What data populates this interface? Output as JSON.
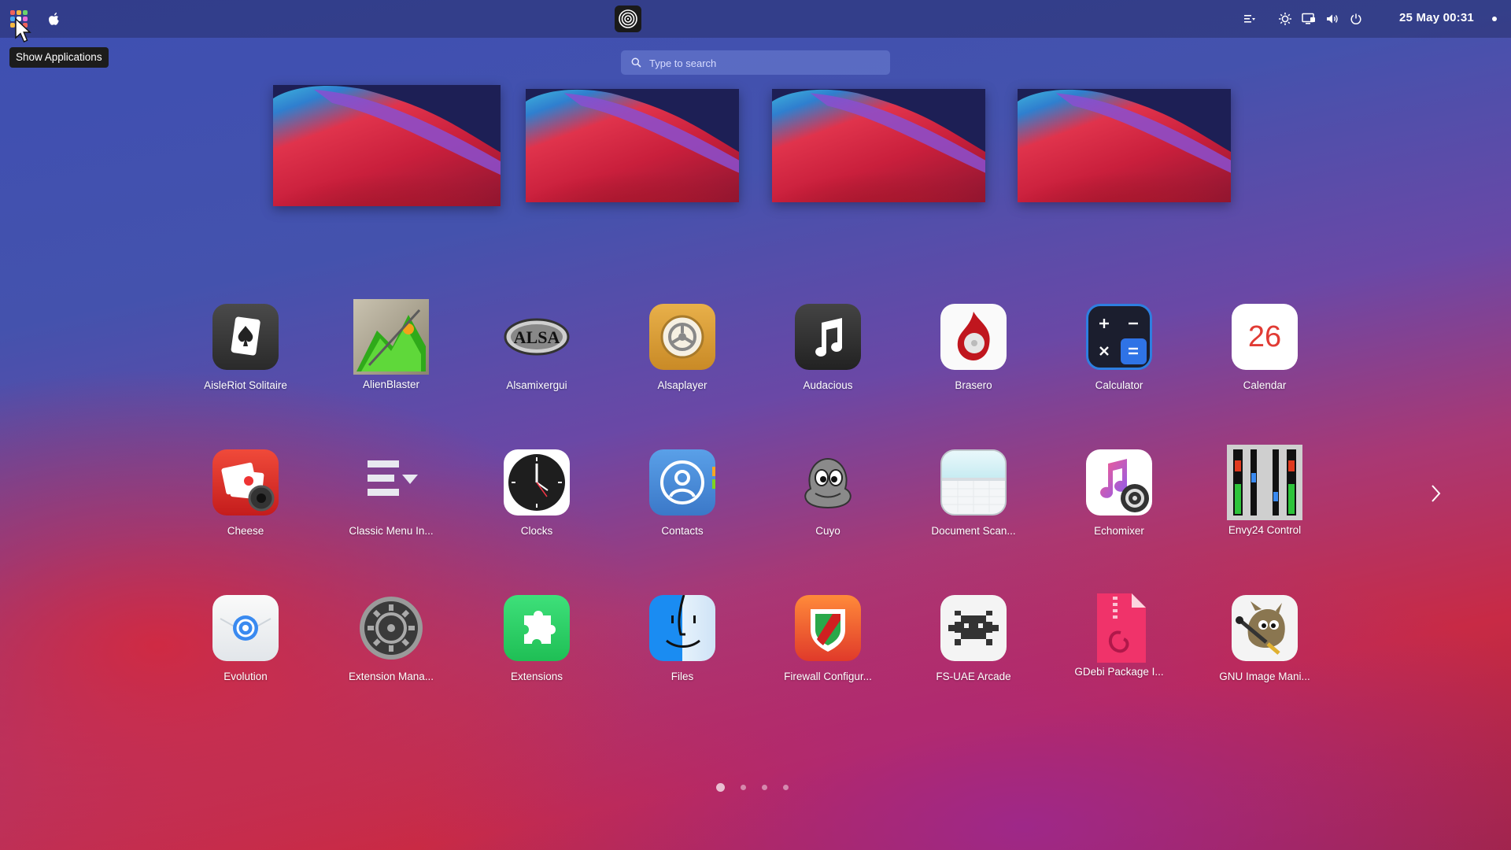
{
  "topbar": {
    "clock": "25 May  00:31",
    "tooltip": "Show Applications"
  },
  "search": {
    "placeholder": "Type to search"
  },
  "apps": [
    {
      "label": "AisleRiot Solitaire",
      "icon": "aisleriot-icon"
    },
    {
      "label": "AlienBlaster",
      "icon": "alienblaster-icon"
    },
    {
      "label": "Alsamixergui",
      "icon": "alsa-icon"
    },
    {
      "label": "Alsaplayer",
      "icon": "alsaplayer-icon"
    },
    {
      "label": "Audacious",
      "icon": "audacious-icon"
    },
    {
      "label": "Brasero",
      "icon": "brasero-icon"
    },
    {
      "label": "Calculator",
      "icon": "calculator-icon"
    },
    {
      "label": "Calendar",
      "icon": "calendar-icon",
      "badge": "26"
    },
    {
      "label": "Cheese",
      "icon": "cheese-icon"
    },
    {
      "label": "Classic Menu In...",
      "icon": "classic-menu-icon"
    },
    {
      "label": "Clocks",
      "icon": "clocks-icon"
    },
    {
      "label": "Contacts",
      "icon": "contacts-icon"
    },
    {
      "label": "Cuyo",
      "icon": "cuyo-icon"
    },
    {
      "label": "Document Scan...",
      "icon": "document-scanner-icon"
    },
    {
      "label": "Echomixer",
      "icon": "echomixer-icon"
    },
    {
      "label": "Envy24 Control",
      "icon": "envy24-icon"
    },
    {
      "label": "Evolution",
      "icon": "evolution-icon"
    },
    {
      "label": "Extension Mana...",
      "icon": "extension-manager-icon"
    },
    {
      "label": "Extensions",
      "icon": "extensions-icon"
    },
    {
      "label": "Files",
      "icon": "files-icon"
    },
    {
      "label": "Firewall Configur...",
      "icon": "firewall-icon"
    },
    {
      "label": "FS-UAE Arcade",
      "icon": "fs-uae-icon"
    },
    {
      "label": "GDebi Package I...",
      "icon": "gdebi-icon"
    },
    {
      "label": "GNU Image Mani...",
      "icon": "gimp-icon"
    }
  ],
  "pager": {
    "pages": 4,
    "active": 1
  },
  "colors": {
    "topbar": "#2c3470",
    "accent": "#2a6ee6"
  }
}
